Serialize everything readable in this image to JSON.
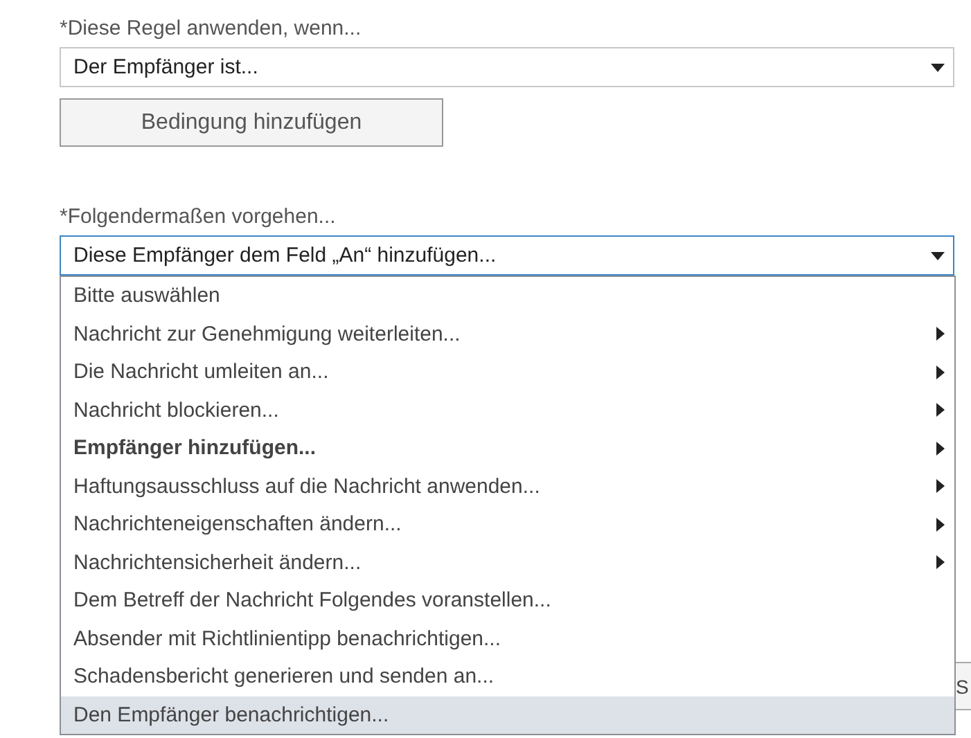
{
  "condition": {
    "label": "*Diese Regel anwenden, wenn...",
    "value": "Der Empfänger ist...",
    "add_button": "Bedingung hinzufügen"
  },
  "action": {
    "label": "*Folgendermaßen vorgehen...",
    "value": "Diese Empfänger dem Feld „An“ hinzufügen...",
    "expanded": true,
    "options": [
      {
        "label": "Bitte auswählen",
        "submenu": false,
        "bold": false,
        "selected": false
      },
      {
        "label": "Nachricht zur Genehmigung weiterleiten...",
        "submenu": true,
        "bold": false,
        "selected": false
      },
      {
        "label": "Die Nachricht umleiten an...",
        "submenu": true,
        "bold": false,
        "selected": false
      },
      {
        "label": "Nachricht blockieren...",
        "submenu": true,
        "bold": false,
        "selected": false
      },
      {
        "label": "Empfänger hinzufügen...",
        "submenu": true,
        "bold": true,
        "selected": false
      },
      {
        "label": "Haftungsausschluss auf die Nachricht anwenden...",
        "submenu": true,
        "bold": false,
        "selected": false
      },
      {
        "label": "Nachrichteneigenschaften ändern...",
        "submenu": true,
        "bold": false,
        "selected": false
      },
      {
        "label": "Nachrichtensicherheit ändern...",
        "submenu": true,
        "bold": false,
        "selected": false
      },
      {
        "label": "Dem Betreff der Nachricht Folgendes voranstellen...",
        "submenu": false,
        "bold": false,
        "selected": false
      },
      {
        "label": "Absender mit Richtlinientipp benachrichtigen...",
        "submenu": false,
        "bold": false,
        "selected": false
      },
      {
        "label": "Schadensbericht generieren und senden an...",
        "submenu": false,
        "bold": false,
        "selected": false
      },
      {
        "label": "Den Empfänger benachrichtigen...",
        "submenu": false,
        "bold": false,
        "selected": true
      }
    ]
  },
  "background_button": "S"
}
